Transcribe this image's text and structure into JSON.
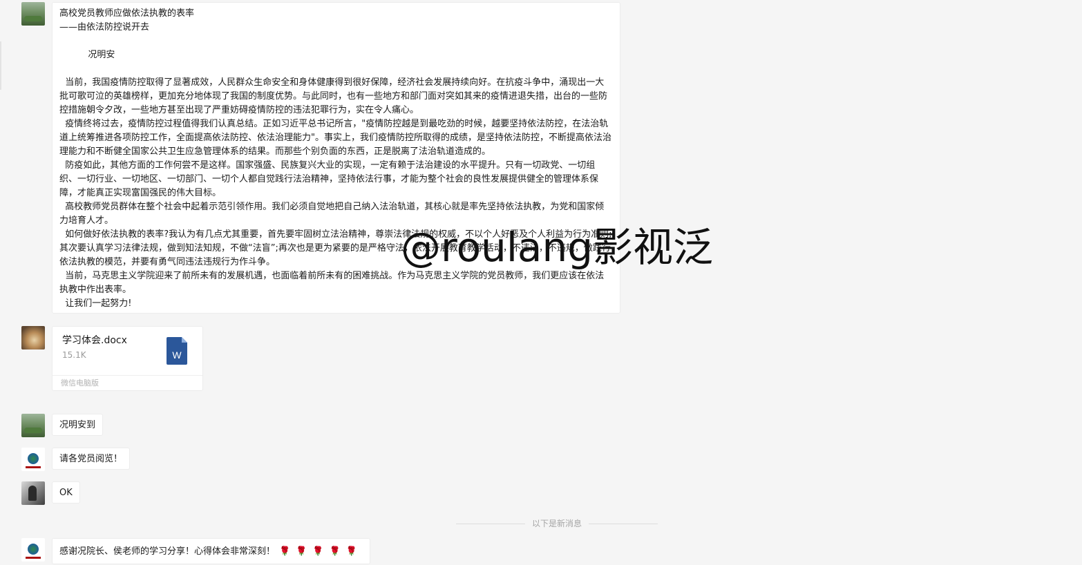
{
  "messages": {
    "article": {
      "text": "高校党员教师应做依法执教的表率\n——由依法防控说开去\n\n          况明安\n\n  当前，我国疫情防控取得了显著成效，人民群众生命安全和身体健康得到很好保障，经济社会发展持续向好。在抗疫斗争中，涌现出一大批可歌可泣的英雄榜样，更加充分地体现了我国的制度优势。与此同时，也有一些地方和部门面对突如其来的疫情进退失措，出台的一些防控措施朝令夕改，一些地方甚至出现了严重妨碍疫情防控的违法犯罪行为，实在令人痛心。\n  疫情终将过去，疫情防控过程值得我们认真总结。正如习近平总书记所言，\"疫情防控越是到最吃劲的时候，越要坚持依法防控，在法治轨道上统筹推进各项防控工作，全面提高依法防控、依法治理能力\"。事实上，我们疫情防控所取得的成绩，是坚持依法防控，不断提高依法治理能力和不断健全国家公共卫生应急管理体系的结果。而那些个别负面的东西，正是脱离了法治轨道造成的。\n  防疫如此，其他方面的工作何尝不是这样。国家强盛、民族复兴大业的实现，一定有赖于法治建设的水平提升。只有一切政党、一切组织、一切行业、一切地区、一切部门、一切个人都自觉践行法治精神，坚持依法行事，才能为整个社会的良性发展提供健全的管理体系保障，才能真正实现富国强民的伟大目标。\n  高校教师党员群体在整个社会中起着示范引领作用。我们必须自觉地把自己纳入法治轨道，其核心就是率先坚持依法执教，为党和国家倾力培育人才。\n  如何做好依法执教的表率?我认为有几点尤其重要，首先要牢固树立法治精神，尊崇法律法规的权威，不以个人好恶及个人利益为行为准则;其次要认真学习法律法规，做到知法知规，不做“法盲”;再次也是更为紧要的是严格守法，依法开展教育教学活动，不违法，不违规，做践行依法执教的模范，并要有勇气同违法违规行为作斗争。\n  当前，马克思主义学院迎来了前所未有的发展机遇，也面临着前所未有的困难挑战。作为马克思主义学院的党员教师，我们更应该在依法执教中作出表率。\n  让我们一起努力!"
    },
    "file": {
      "name": "学习体会.docx",
      "size": "15.1K",
      "icon_letter": "W",
      "source": "微信电脑版"
    },
    "msg1": "况明安到",
    "msg2": "请各党员阅览！",
    "msg3": "OK",
    "divider": "以下是新消息",
    "msg4": "感谢况院长、侯老师的学习分享！心得体会非常深刻！",
    "msg4_roses": "🌹🌹🌹🌹🌹"
  },
  "watermark": "@roulang影视泛",
  "colors": {
    "background": "#f5f5f5",
    "bubble": "#ffffff",
    "word_icon": "#2b579a",
    "muted_text": "#a5a5a5"
  },
  "icons": {
    "file": "word-document-icon",
    "rose": "rose-emoji"
  }
}
